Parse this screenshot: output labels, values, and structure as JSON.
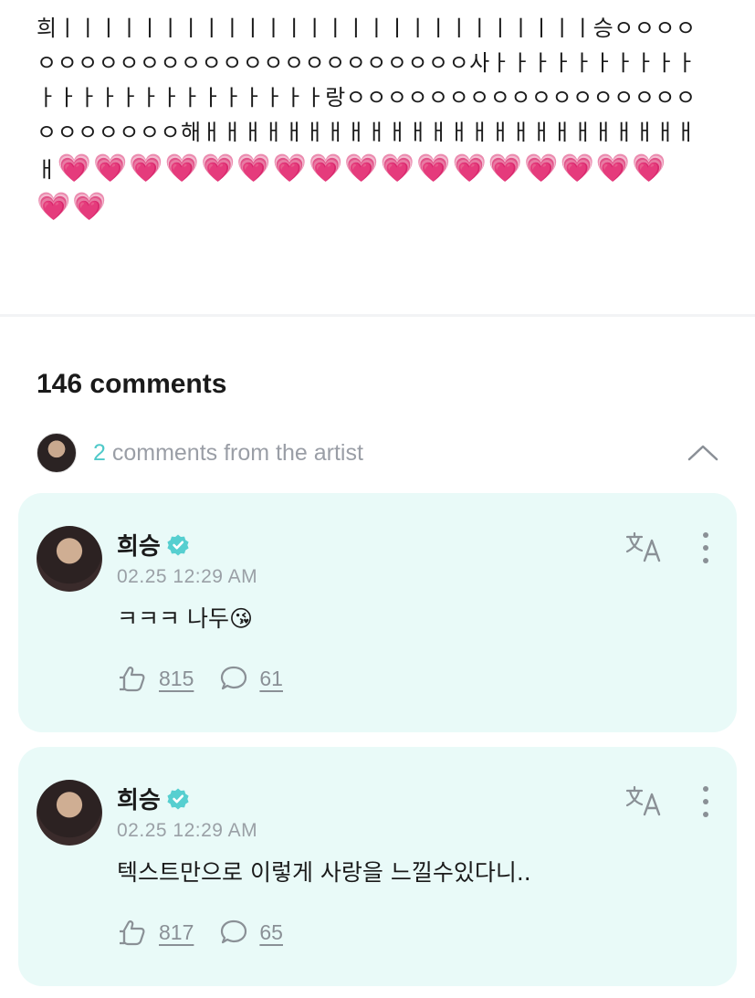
{
  "post": {
    "body": "희ㅣㅣㅣㅣㅣㅣㅣㅣㅣㅣㅣㅣㅣㅣㅣㅣㅣㅣㅣㅣㅣㅣㅣㅣㅣㅣ승ㅇㅇㅇㅇㅇㅇㅇㅇㅇㅇㅇㅇㅇㅇㅇㅇㅇㅇㅇㅇㅇㅇㅇㅇㅇ사ㅏㅏㅏㅏㅏㅏㅏㅏㅏㅏㅏㅏㅏㅏㅏㅏㅏㅏㅏㅏㅏㅏㅏㅏ랑ㅇㅇㅇㅇㅇㅇㅇㅇㅇㅇㅇㅇㅇㅇㅇㅇㅇㅇㅇㅇㅇㅇㅇㅇ해ㅐㅐㅐㅐㅐㅐㅐㅐㅐㅐㅐㅐㅐㅐㅐㅐㅐㅐㅐㅐㅐㅐㅐㅐㅐ",
    "hearts": "💗💗💗💗💗💗💗💗💗💗💗💗💗💗💗💗💗💗💗"
  },
  "comments_section": {
    "count_label": "146 comments",
    "artist_count": "2",
    "artist_label": " comments from the artist",
    "collapse_icon": "chevron-up-icon"
  },
  "comments": [
    {
      "author": "희승",
      "verified_icon": "verified-badge-icon",
      "time": "02.25 12:29 AM",
      "text": "ㅋㅋㅋ 나두😘",
      "likes": "815",
      "replies": "61"
    },
    {
      "author": "희승",
      "verified_icon": "verified-badge-icon",
      "time": "02.25 12:29 AM",
      "text": "텍스트만으로 이렇게 사랑을 느낄수있다니..",
      "likes": "817",
      "replies": "65"
    }
  ],
  "colors": {
    "accent": "#4fc9c9",
    "card_bg": "#e9faf8",
    "muted": "#9aa0a6"
  }
}
